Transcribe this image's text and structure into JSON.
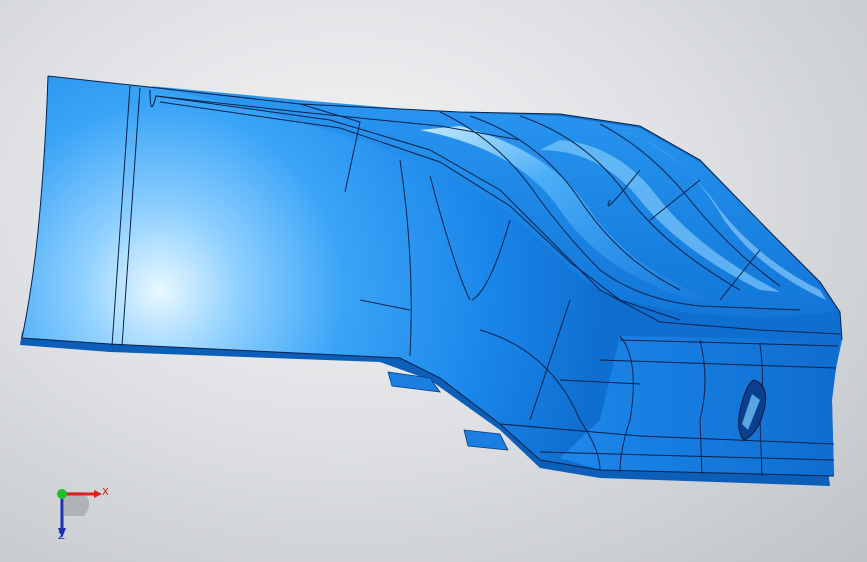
{
  "viewport": {
    "model": "blue-surface-duct-part",
    "background": "#d6d8db",
    "model_color": "#1e8ef0"
  },
  "triad": {
    "x_label": "X",
    "z_label": "Z",
    "colors": {
      "x": "#e02020",
      "y": "#1fbf2a",
      "z": "#1a2fb8"
    }
  }
}
